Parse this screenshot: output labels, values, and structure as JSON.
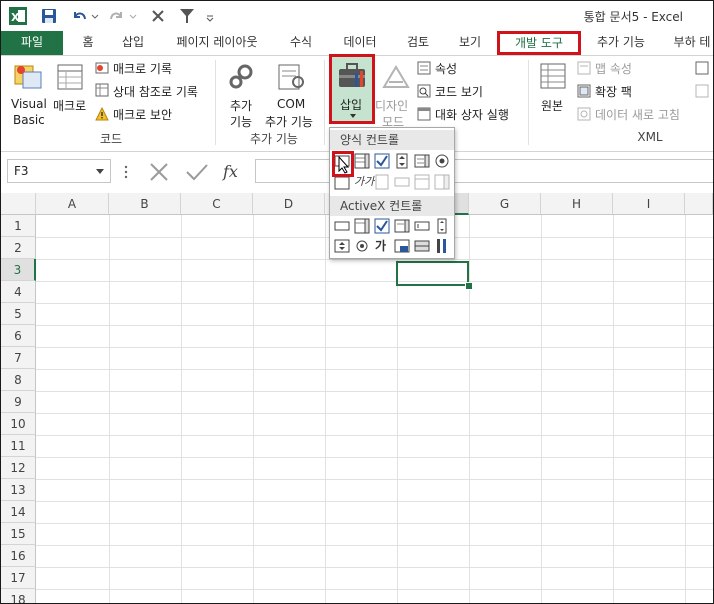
{
  "window": {
    "title": "통합 문서5 - Excel"
  },
  "tabs": [
    "파일",
    "홈",
    "삽입",
    "페이지 레이아웃",
    "수식",
    "데이터",
    "검토",
    "보기",
    "개발 도구",
    "추가 기능",
    "부하 테"
  ],
  "ribbon": {
    "code": {
      "visual_basic_1": "Visual",
      "visual_basic_2": "Basic",
      "macro": "매크로",
      "record_macro": "매크로 기록",
      "relative_ref": "상대 참조로 기록",
      "macro_security": "매크로 보안",
      "label": "코드"
    },
    "addins": {
      "addins_1": "추가",
      "addins_2": "기능",
      "com_1": "COM",
      "com_2": "추가 기능",
      "label": "추가 기능"
    },
    "controls": {
      "insert": "삽입",
      "design_1": "디자인",
      "design_2": "모드",
      "properties": "속성",
      "view_code": "코드 보기",
      "run_dialog": "대화 상자 실행"
    },
    "xml": {
      "source": "원본",
      "map_properties": "맵 속성",
      "expansion_packs": "확장 팩",
      "refresh_data": "데이터 새로 고침",
      "label": "XML"
    }
  },
  "formula_bar": {
    "name_box": "F3",
    "fx": "fx",
    "value": ""
  },
  "grid": {
    "columns": [
      "A",
      "B",
      "C",
      "D",
      "E",
      "F",
      "G",
      "H",
      "I"
    ],
    "rows": [
      "1",
      "2",
      "3",
      "4",
      "5",
      "6",
      "7",
      "8",
      "9",
      "10",
      "11",
      "12",
      "13",
      "14",
      "15",
      "16",
      "17",
      "18"
    ],
    "active_cell": "F3"
  },
  "dropdown": {
    "form_controls_title": "양식 컨트롤",
    "activex_controls_title": "ActiveX 컨트롤",
    "ga_label": "가",
    "ga_small_label": "가가"
  },
  "colors": {
    "excel_green": "#217346",
    "highlight_red": "#d0121b",
    "insert_bg": "#c5e3cf"
  }
}
